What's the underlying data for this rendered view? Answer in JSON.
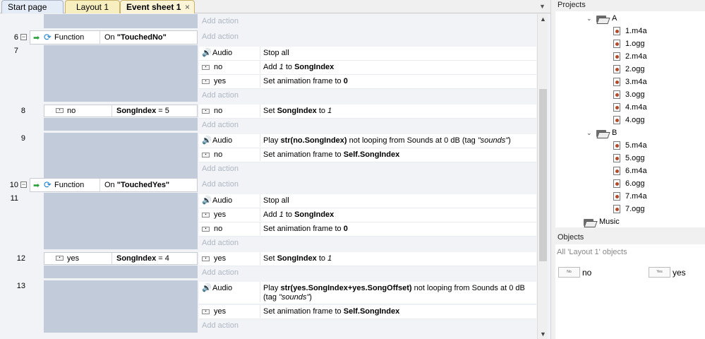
{
  "tabs": [
    {
      "label": "Start page"
    },
    {
      "label": "Layout 1"
    },
    {
      "label": "Event sheet 1",
      "close": "×"
    }
  ],
  "tabs_menu_icon": "chevron-down-icon",
  "add_action_label": "Add action",
  "events": {
    "e6": {
      "num": "6",
      "expander": "−",
      "header_label": "Function",
      "header_cond": "On \"TouchedNo\""
    },
    "e7": {
      "num": "7",
      "actions": [
        {
          "obj": "Audio",
          "text": "Stop all"
        },
        {
          "obj": "no",
          "text": "Add 1 to SongIndex"
        },
        {
          "obj": "yes",
          "text": "Set animation frame to 0"
        }
      ]
    },
    "e8": {
      "num": "8",
      "cond_obj": "no",
      "cond_text": "SongIndex = 5",
      "actions": [
        {
          "obj": "no",
          "text": "Set SongIndex to 1"
        }
      ]
    },
    "e9": {
      "num": "9",
      "actions": [
        {
          "obj": "Audio",
          "text": "Play str(no.SongIndex) not looping from Sounds at 0 dB (tag \"sounds\")"
        },
        {
          "obj": "no",
          "text": "Set animation frame to Self.SongIndex"
        }
      ]
    },
    "e10": {
      "num": "10",
      "expander": "−",
      "header_label": "Function",
      "header_cond": "On \"TouchedYes\""
    },
    "e11": {
      "num": "11",
      "actions": [
        {
          "obj": "Audio",
          "text": "Stop all"
        },
        {
          "obj": "yes",
          "text": "Add 1 to SongIndex"
        },
        {
          "obj": "no",
          "text": "Set animation frame to 0"
        }
      ]
    },
    "e12": {
      "num": "12",
      "cond_obj": "yes",
      "cond_text": "SongIndex = 4",
      "actions": [
        {
          "obj": "yes",
          "text": "Set SongIndex to 1"
        }
      ]
    },
    "e13": {
      "num": "13",
      "actions": [
        {
          "obj": "Audio",
          "text": "Play str(yes.SongIndex+yes.SongOffset) not looping from Sounds at 0 dB (tag \"sounds\")"
        },
        {
          "obj": "yes",
          "text": "Set animation frame to Self.SongIndex"
        }
      ]
    }
  },
  "projects": {
    "title": "Projects",
    "folders": [
      {
        "name": "A",
        "files": [
          "1.m4a",
          "1.ogg",
          "2.m4a",
          "2.ogg",
          "3.m4a",
          "3.ogg",
          "4.m4a",
          "4.ogg"
        ]
      },
      {
        "name": "B",
        "files": [
          "5.m4a",
          "5.ogg",
          "6.m4a",
          "6.ogg",
          "7.m4a",
          "7.ogg"
        ]
      },
      {
        "name": "Music",
        "files": []
      }
    ]
  },
  "objects": {
    "title": "Objects",
    "filter": "All 'Layout 1' objects",
    "items": [
      {
        "label": "no",
        "thumb": "No"
      },
      {
        "label": "yes",
        "thumb": "Yes"
      }
    ]
  },
  "colors": {
    "condition_block": "#c1cbda",
    "condition_row": "#dfe6f1",
    "add_action_text": "#aeb7c4",
    "audio_icon": "#1f6fb5",
    "tab_active": "#fbf4d6"
  }
}
